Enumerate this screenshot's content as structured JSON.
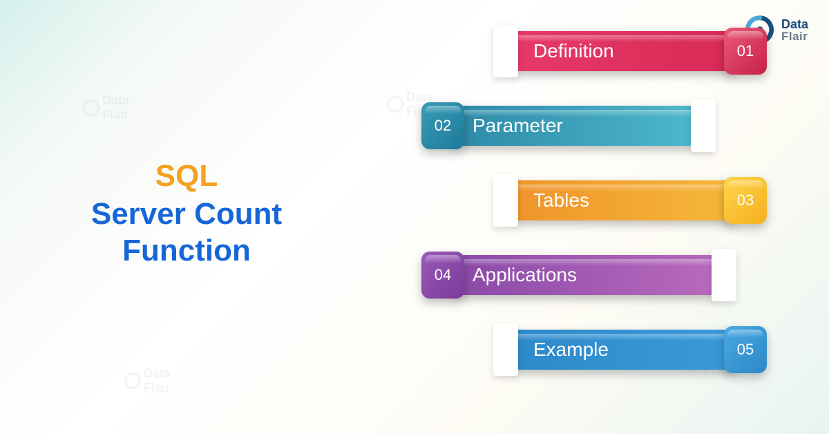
{
  "logo": {
    "line1": "Data",
    "line2": "Flair"
  },
  "title": {
    "line1": "SQL",
    "line2": "Server Count Function"
  },
  "items": [
    {
      "num": "01",
      "label": "Definition"
    },
    {
      "num": "02",
      "label": "Parameter"
    },
    {
      "num": "03",
      "label": "Tables"
    },
    {
      "num": "04",
      "label": "Applications"
    },
    {
      "num": "05",
      "label": "Example"
    }
  ],
  "colors": {
    "title_accent": "#f5a122",
    "title_main": "#1666d8",
    "item1": "#e63968",
    "item2": "#2d8aa8",
    "item3": "#f0942a",
    "item4": "#8a4aa8",
    "item5": "#2d8aca"
  }
}
